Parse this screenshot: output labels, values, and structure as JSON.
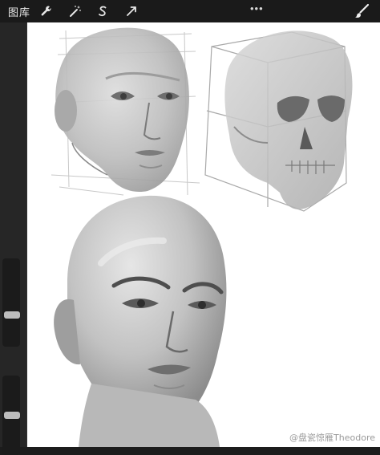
{
  "topbar": {
    "gallery_label": "图库",
    "tools": [
      "wrench-icon",
      "magic-wand-icon",
      "selection-icon",
      "transform-arrow-icon"
    ],
    "more_label": "•••",
    "active_tool": "brush-icon"
  },
  "sidebar": {
    "brush_size_level": 0.35,
    "opacity_level": 0.5
  },
  "watermark": {
    "text": "@盘瓷惊雁Theodore"
  },
  "colors": {
    "toolbar_bg": "#1a1a1a",
    "sidebar_bg": "#262626",
    "canvas_bg": "#ffffff"
  }
}
